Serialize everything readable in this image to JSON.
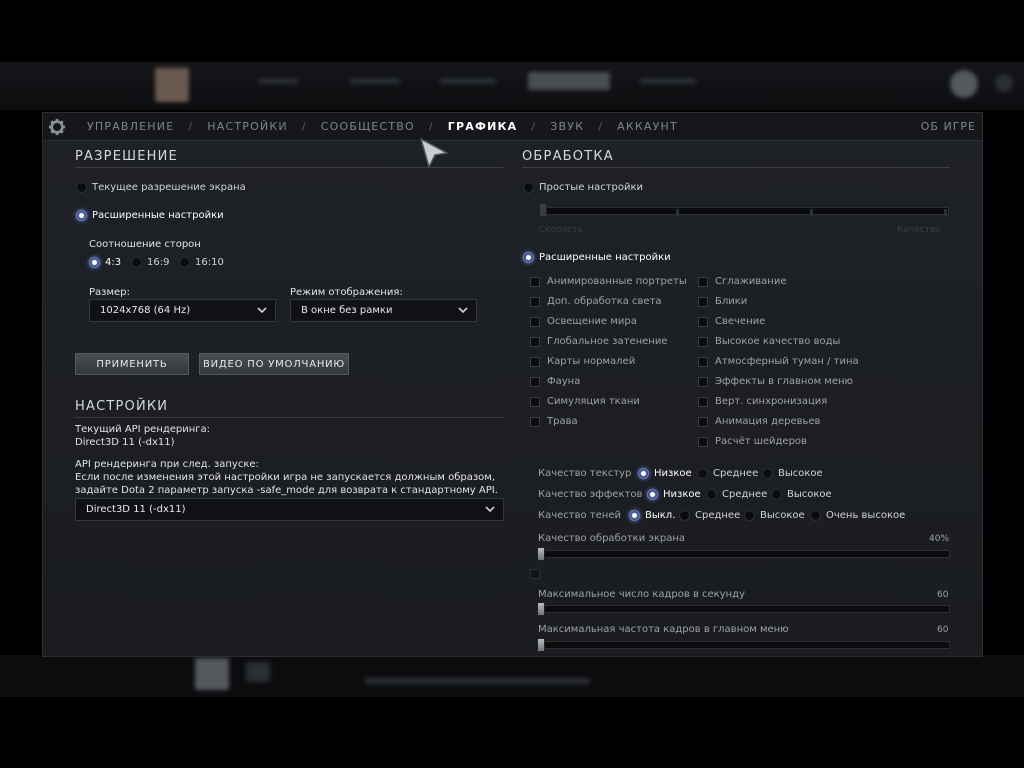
{
  "nav": {
    "items": [
      "УПРАВЛЕНИЕ",
      "НАСТРОЙКИ",
      "СООБЩЕСТВО",
      "ГРАФИКА",
      "ЗВУК",
      "АККАУНТ"
    ],
    "separator": "/",
    "active_index": 3,
    "about": "ОБ ИГРЕ"
  },
  "resolution": {
    "title": "РАЗРЕШЕНИЕ",
    "current_option": "Текущее разрешение экрана",
    "advanced_option": "Расширенные настройки",
    "aspect_label": "Соотношение сторон",
    "aspect_options": [
      "4:3",
      "16:9",
      "16:10"
    ],
    "aspect_selected": "4:3",
    "size_label": "Размер:",
    "size_value": "1024x768 (64 Hz)",
    "mode_label": "Режим отображения:",
    "mode_value": "В окне без рамки",
    "apply_button": "ПРИМЕНИТЬ",
    "default_video_button": "ВИДЕО ПО УМОЛЧАНИЮ"
  },
  "settings": {
    "title": "НАСТРОЙКИ",
    "current_api_label": "Текущий API рендеринга:",
    "current_api_value": "Direct3D 11 (-dx11)",
    "next_api_label": "API рендеринга при след. запуске:",
    "next_api_note_1": "Если после изменения этой настройки игра не запускается должным образом,",
    "next_api_note_2": "задайте Dota 2 параметр запуска -safe_mode для возврата к стандартному API.",
    "api_dropdown_value": "Direct3D 11 (-dx11)"
  },
  "rendering": {
    "title": "ОБРАБОТКА",
    "simple_option": "Простые настройки",
    "simple_slider_left": "Скорость",
    "simple_slider_right": "Качество",
    "advanced_option": "Расширенные настройки",
    "checkboxes_left": [
      "Анимированные портреты",
      "Доп. обработка света",
      "Освещение мира",
      "Глобальное затенение",
      "Карты нормалей",
      "Фауна",
      "Симуляция ткани",
      "Трава"
    ],
    "checkboxes_right": [
      "Сглаживание",
      "Блики",
      "Свечение",
      "Высокое качество воды",
      "Атмосферный туман / тина",
      "Эффекты в главном меню",
      "Верт. синхронизация",
      "Анимация деревьев",
      "Расчёт шейдеров"
    ],
    "texture_quality_label": "Качество текстур",
    "texture_options": [
      "Низкое",
      "Среднее",
      "Высокое"
    ],
    "effects_quality_label": "Качество эффектов",
    "effects_options": [
      "Низкое",
      "Среднее",
      "Высокое"
    ],
    "shadow_quality_label": "Качество теней",
    "shadow_options": [
      "Выкл.",
      "Среднее",
      "Высокое",
      "Очень высокое"
    ],
    "screen_quality_label": "Качество обработки экрана",
    "screen_quality_value": "40%",
    "screen_quality_fraction": 0.0,
    "fps_label": "Максимальное число кадров в секунду",
    "fps_value": "60",
    "menu_fps_label": "Максимальная частота кадров в главном меню",
    "menu_fps_value": "60"
  }
}
